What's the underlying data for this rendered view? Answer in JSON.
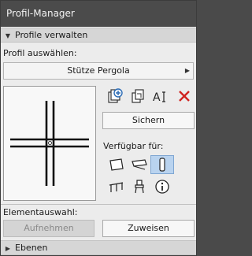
{
  "window": {
    "title": "Profil-Manager"
  },
  "section_profiles": {
    "header": "Profile verwalten"
  },
  "profile_select": {
    "label": "Profil auswählen:",
    "value": "Stütze Pergola"
  },
  "actions": {
    "save_label": "Sichern"
  },
  "availability": {
    "label": "Verfügbar für:"
  },
  "element_selection": {
    "label": "Elementauswahl:",
    "capture_label": "Aufnehmen",
    "assign_label": "Zuweisen"
  },
  "section_layers": {
    "header": "Ebenen"
  },
  "colors": {
    "titlebar": "#4b4b4b",
    "selected": "#b9d3ef",
    "delete": "#d0231f",
    "accent": "#2a6bb5"
  }
}
